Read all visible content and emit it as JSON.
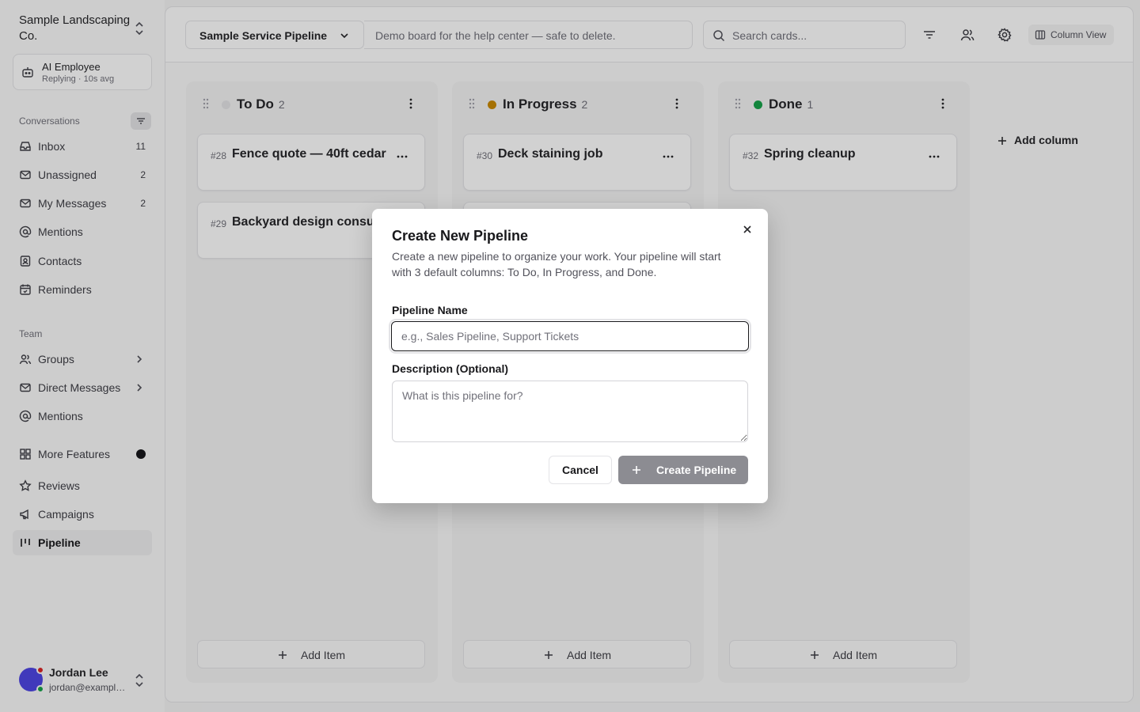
{
  "sidebar": {
    "org_name": "Sample Landscaping Co.",
    "ai": {
      "title": "AI Employee",
      "subtitle": "Replying · 10s avg"
    },
    "conversations_label": "Conversations",
    "conversations": [
      {
        "label": "Inbox",
        "count": "11",
        "icon": "inbox-icon"
      },
      {
        "label": "Unassigned",
        "count": "2",
        "icon": "mail-icon"
      },
      {
        "label": "My Messages",
        "count": "2",
        "icon": "mail-icon"
      },
      {
        "label": "Mentions",
        "count": "",
        "icon": "at-icon"
      },
      {
        "label": "Contacts",
        "count": "",
        "icon": "contact-icon"
      },
      {
        "label": "Reminders",
        "count": "",
        "icon": "calendar-icon"
      }
    ],
    "team_label": "Team",
    "team": [
      {
        "label": "Groups",
        "icon": "users-icon"
      },
      {
        "label": "Direct Messages",
        "icon": "mail-icon"
      },
      {
        "label": "Mentions",
        "icon": "at-icon"
      }
    ],
    "more": [
      {
        "label": "More Features",
        "icon": "grid-icon"
      },
      {
        "label": "Reviews",
        "icon": "star-icon"
      },
      {
        "label": "Campaigns",
        "icon": "megaphone-icon"
      },
      {
        "label": "Pipeline",
        "icon": "pipeline-icon"
      }
    ],
    "user": {
      "name": "Jordan Lee",
      "email": "jordan@example.com"
    }
  },
  "topbar": {
    "pipeline_name": "Sample Service Pipeline",
    "pipeline_description": "Demo board for the help center — safe to delete.",
    "search_placeholder": "Search cards...",
    "view_label": "Column View"
  },
  "board": {
    "columns": [
      {
        "title": "To Do",
        "count": "2",
        "color": "#e4e4e7",
        "cards": [
          {
            "num": "#28",
            "title": "Fence quote — 40ft cedar"
          },
          {
            "num": "#29",
            "title": "Backyard design consultation"
          }
        ]
      },
      {
        "title": "In Progress",
        "count": "2",
        "color": "#ca8a04",
        "cards": [
          {
            "num": "#30",
            "title": "Deck staining job"
          }
        ]
      },
      {
        "title": "Done",
        "count": "1",
        "color": "#16a34a",
        "cards": [
          {
            "num": "#32",
            "title": "Spring cleanup"
          }
        ]
      }
    ],
    "add_item_label": "Add Item",
    "add_column_label": "Add column"
  },
  "modal": {
    "title": "Create New Pipeline",
    "description": "Create a new pipeline to organize your work. Your pipeline will start with 3 default columns: To Do, In Progress, and Done.",
    "name_label": "Pipeline Name",
    "name_placeholder": "e.g., Sales Pipeline, Support Tickets",
    "name_value": "",
    "desc_label": "Description (Optional)",
    "desc_placeholder": "What is this pipeline for?",
    "desc_value": "",
    "cancel_label": "Cancel",
    "create_label": "Create Pipeline"
  }
}
